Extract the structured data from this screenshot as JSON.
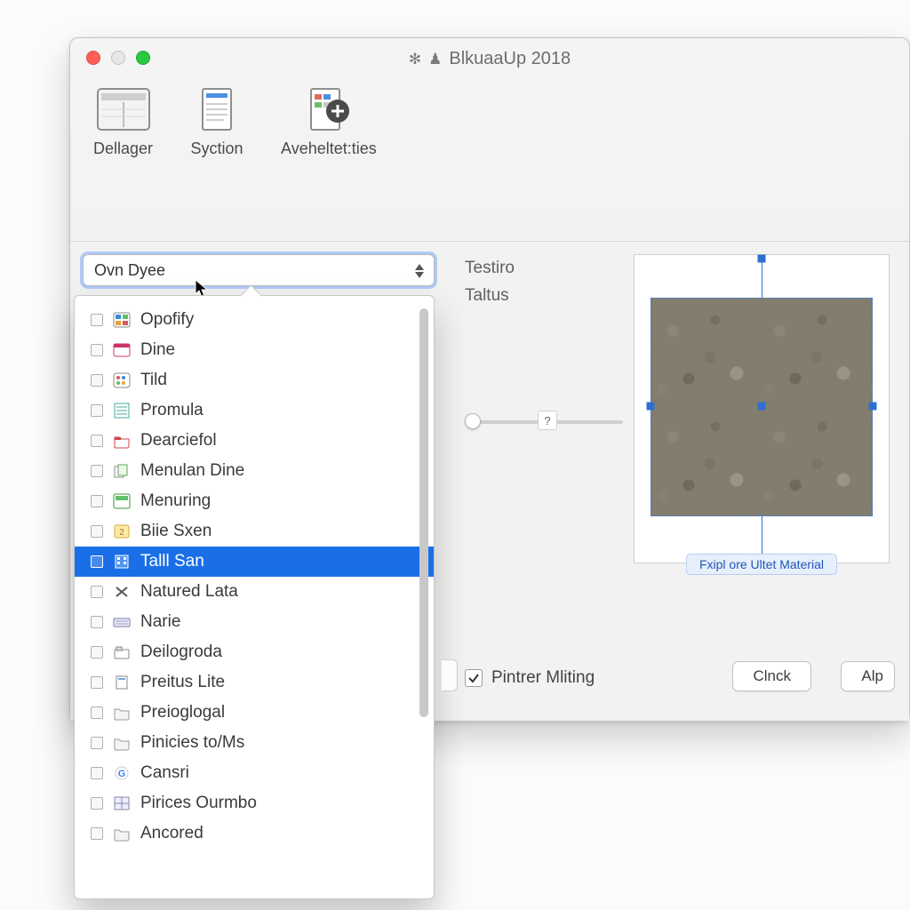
{
  "window": {
    "title": "BlkuaaUp 2018",
    "traffic": {
      "close": "close",
      "min": "minimize",
      "zoom": "zoom"
    }
  },
  "toolbar": {
    "items": [
      {
        "label": "Dellager"
      },
      {
        "label": "Syction"
      },
      {
        "label": "Aveheltet:ties"
      }
    ]
  },
  "combo": {
    "value": "Ovn Dyee"
  },
  "dropdown": {
    "selected_index": 8,
    "items": [
      {
        "label": "Opofify",
        "icon": "app-color-icon"
      },
      {
        "label": "Dine",
        "icon": "window-icon"
      },
      {
        "label": "Tild",
        "icon": "palette-icon"
      },
      {
        "label": "Promula",
        "icon": "sheet-icon"
      },
      {
        "label": "Dearciefol",
        "icon": "folder-red-icon"
      },
      {
        "label": "Menulan Dine",
        "icon": "cards-icon"
      },
      {
        "label": "Menuring",
        "icon": "app-green-icon"
      },
      {
        "label": "Biie Sxen",
        "icon": "numbered-icon"
      },
      {
        "label": "Talll San",
        "icon": "building-icon"
      },
      {
        "label": "Natured Lata",
        "icon": "x-icon"
      },
      {
        "label": "Narie",
        "icon": "keyboard-icon"
      },
      {
        "label": "Deilogroda",
        "icon": "folder-tab-icon"
      },
      {
        "label": "Preitus Lite",
        "icon": "doc-icon"
      },
      {
        "label": "Preioglogal",
        "icon": "folder-icon"
      },
      {
        "label": "Pinicies to/Ms",
        "icon": "folder-icon"
      },
      {
        "label": "Cansri",
        "icon": "g-icon"
      },
      {
        "label": "Pirices Ourmbo",
        "icon": "grid-icon"
      },
      {
        "label": "Ancored",
        "icon": "folder-icon"
      }
    ]
  },
  "right": {
    "label_line1": "Testiro",
    "label_line2": "Taltus",
    "slider_value": "?",
    "preview_caption": "Fxipl ore Ultet Material",
    "checkbox_label": "Pintrer Mliting",
    "checkbox_checked": true,
    "button1": "Clnck",
    "button2": "Alp"
  }
}
